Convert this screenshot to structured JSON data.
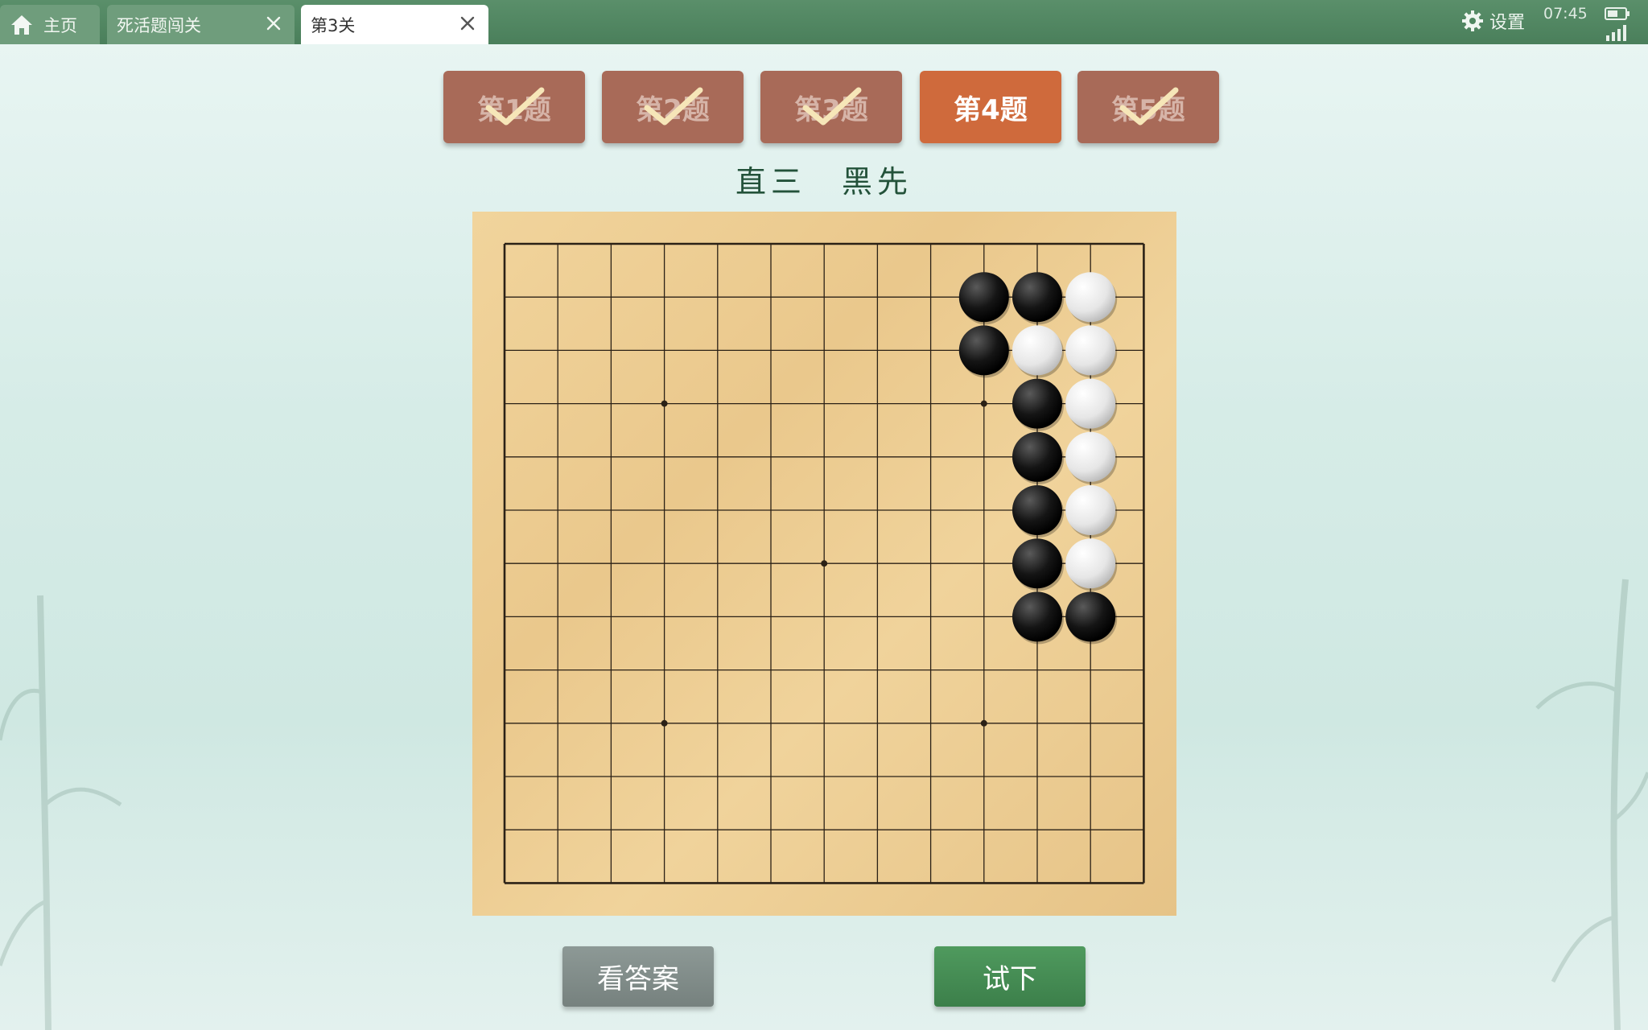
{
  "tabs": [
    {
      "label": "主页",
      "icon": "home-icon"
    },
    {
      "label": "死活题闯关",
      "closable": true
    },
    {
      "label": "第3关",
      "closable": true,
      "active": true
    }
  ],
  "status": {
    "settings_label": "设置",
    "time": "07:45"
  },
  "questions": [
    {
      "label": "第1题",
      "solved": true
    },
    {
      "label": "第2题",
      "solved": true
    },
    {
      "label": "第3题",
      "solved": true
    },
    {
      "label": "第4题",
      "solved": false,
      "active": true
    },
    {
      "label": "第5题",
      "solved": true
    }
  ],
  "problem_title": "直三　黑先",
  "board": {
    "size": 13,
    "star_points": [
      [
        3,
        3
      ],
      [
        3,
        9
      ],
      [
        6,
        6
      ],
      [
        9,
        3
      ],
      [
        9,
        9
      ]
    ],
    "stones": [
      {
        "color": "black",
        "col": 9,
        "row": 1
      },
      {
        "color": "black",
        "col": 10,
        "row": 1
      },
      {
        "color": "white",
        "col": 11,
        "row": 1
      },
      {
        "color": "black",
        "col": 9,
        "row": 2
      },
      {
        "color": "white",
        "col": 10,
        "row": 2
      },
      {
        "color": "white",
        "col": 11,
        "row": 2
      },
      {
        "color": "black",
        "col": 10,
        "row": 3
      },
      {
        "color": "white",
        "col": 11,
        "row": 3
      },
      {
        "color": "black",
        "col": 10,
        "row": 4
      },
      {
        "color": "white",
        "col": 11,
        "row": 4
      },
      {
        "color": "black",
        "col": 10,
        "row": 5
      },
      {
        "color": "white",
        "col": 11,
        "row": 5
      },
      {
        "color": "black",
        "col": 10,
        "row": 6
      },
      {
        "color": "white",
        "col": 11,
        "row": 6
      },
      {
        "color": "black",
        "col": 10,
        "row": 7
      },
      {
        "color": "black",
        "col": 11,
        "row": 7
      }
    ]
  },
  "actions": {
    "answer_label": "看答案",
    "try_label": "试下"
  }
}
